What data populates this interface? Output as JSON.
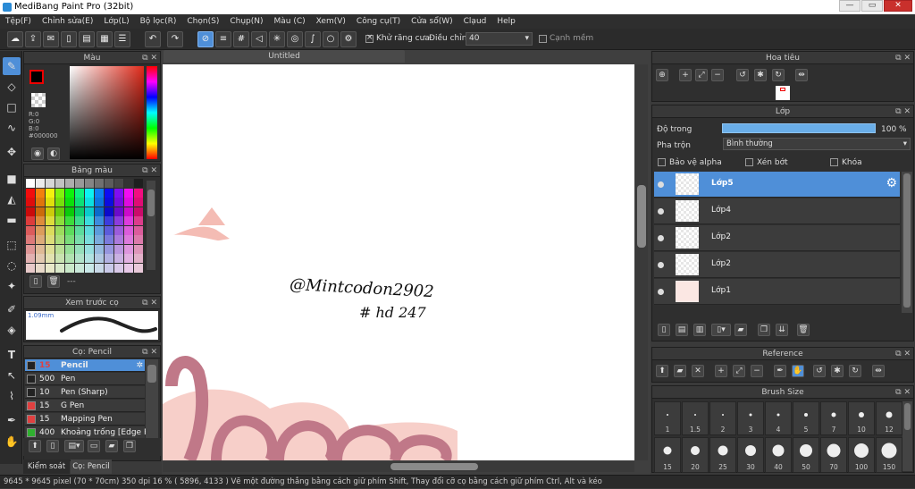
{
  "window": {
    "title": "MediBang Paint Pro (32bit)",
    "min": "—",
    "max": "▭",
    "close": "✕"
  },
  "menu": [
    "Tệp(F)",
    "Chỉnh sửa(E)",
    "Lớp(L)",
    "Bộ lọc(R)",
    "Chọn(S)",
    "Chụp(N)",
    "Màu (C)",
    "Xem(V)",
    "Công cụ(T)",
    "Cửa sổ(W)",
    "Clạud",
    "Help"
  ],
  "toolbar": {
    "antialias_label": "Khử răng cưa",
    "antialias_checked": true,
    "adjust_label": "Điều chỉnh",
    "adjust_value": "40",
    "smooth_label": "Cạnh mềm"
  },
  "color_panel": {
    "title": "Màu",
    "r": "R:0",
    "g": "G:0",
    "b": "B:0",
    "hex": "#000000"
  },
  "swatch_panel": {
    "title": "Bảng màu",
    "dots": "---"
  },
  "preview_panel": {
    "title": "Xem trước cọ",
    "size": "1.09mm"
  },
  "brush_panel": {
    "title": "Cọ: Pencil",
    "items": [
      {
        "size": "15",
        "name": "Pencil",
        "color": "#e04040",
        "selected": true
      },
      {
        "size": "500",
        "name": "Pen",
        "color": "#222222"
      },
      {
        "size": "10",
        "name": "Pen (Sharp)",
        "color": "#222222"
      },
      {
        "size": "15",
        "name": "G Pen",
        "color": "#e04040"
      },
      {
        "size": "15",
        "name": "Mapping Pen",
        "color": "#e04040"
      },
      {
        "size": "400",
        "name": "Khoảng trống [Edge Pe",
        "color": "#30b030"
      }
    ]
  },
  "bottom_tabs": {
    "tab1": "Kiểm soát cọ",
    "tab2": "Cọ: Pencil"
  },
  "document": {
    "tab": "Untitled",
    "signature_line1": "@Mintcodon2902",
    "signature_line2": "# hd 247"
  },
  "navigator": {
    "title": "Hoa tiêu"
  },
  "layer_panel": {
    "title": "Lớp",
    "opacity_label": "Độ trong",
    "opacity_value": "100 %",
    "blend_label": "Pha trộn",
    "blend_value": "Bình thường",
    "protect_alpha": "Bảo vệ alpha",
    "clip": "Xén bớt",
    "lock": "Khóa",
    "layers": [
      {
        "name": "Lớp5",
        "selected": true
      },
      {
        "name": "Lớp4"
      },
      {
        "name": "Lớp2"
      },
      {
        "name": "Lớp2"
      },
      {
        "name": "Lớp1"
      }
    ]
  },
  "reference_panel": {
    "title": "Reference"
  },
  "brush_size_panel": {
    "title": "Brush Size",
    "row1": [
      "1",
      "1.5",
      "2",
      "3",
      "4",
      "5",
      "7",
      "10",
      "12"
    ],
    "row2": [
      "15",
      "20",
      "25",
      "30",
      "40",
      "50",
      "70",
      "100",
      "150"
    ]
  },
  "status": "9645 * 9645 pixel   (70 * 70cm)   350 dpi   16 %   ( 5896, 4133 )   Vẽ một đường thẳng bằng cách giữ phím Shift, Thay đổi cỡ cọ bằng cách giữ phím Ctrl, Alt và kéo",
  "colors": {
    "accent": "#4f8fd8",
    "panel": "#2f2f2f",
    "canvas_bg": "#3f3f3f",
    "pink": "#f7cfc9",
    "drawing": "#c07888"
  }
}
